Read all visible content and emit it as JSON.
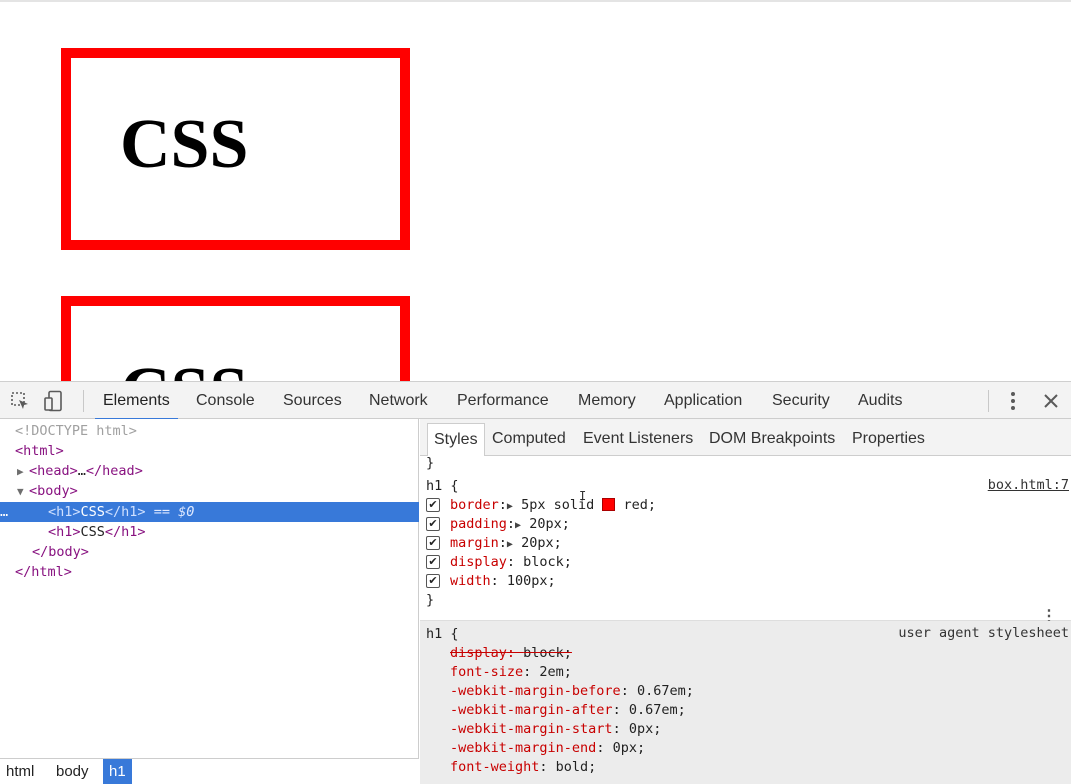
{
  "page": {
    "boxes": [
      {
        "text": "CSS"
      },
      {
        "text": "CSS"
      }
    ]
  },
  "devtools": {
    "toolbar": {
      "tabs": [
        "Elements",
        "Console",
        "Sources",
        "Network",
        "Performance",
        "Memory",
        "Application",
        "Security",
        "Audits"
      ],
      "active_tab": "Elements",
      "icons": [
        "inspect-element-icon",
        "device-toolbar-icon",
        "more-options-icon",
        "close-icon"
      ]
    },
    "elements": {
      "lines": {
        "doctype": "<!DOCTYPE html>",
        "html_open": "<html>",
        "head_open": "<head>",
        "head_ellipsis": "…",
        "head_close": "</head>",
        "body_open": "<body>",
        "h1_open": "<h1>",
        "h1_text": "CSS",
        "h1_close": "</h1>",
        "selected_marker": "== $0",
        "body_close": "</body>",
        "html_close": "</html>"
      },
      "row_ellipsis": "…",
      "breadcrumb": [
        "html",
        "body",
        "h1"
      ]
    },
    "styles": {
      "tabs": [
        "Styles",
        "Computed",
        "Event Listeners",
        "DOM Breakpoints",
        "Properties"
      ],
      "active_tab": "Styles",
      "prev_rule_close": "}",
      "rule1": {
        "selector": "h1 {",
        "source": "box.html:7",
        "close": "}",
        "declarations": [
          {
            "prop": "border",
            "value_pre": "5px solid ",
            "value_post": "red;",
            "swatch": "#ff0000"
          },
          {
            "prop": "padding",
            "value": "20px;"
          },
          {
            "prop": "margin",
            "value": "20px;"
          },
          {
            "prop": "display",
            "value": "block;"
          },
          {
            "prop": "width",
            "value": "100px;"
          }
        ]
      },
      "rule2": {
        "selector": "h1 {",
        "source": "user agent stylesheet",
        "declarations": [
          {
            "prop": "display",
            "value": "block;",
            "overridden": true
          },
          {
            "prop": "font-size",
            "value": "2em;"
          },
          {
            "prop": "-webkit-margin-before",
            "value": "0.67em;"
          },
          {
            "prop": "-webkit-margin-after",
            "value": "0.67em;"
          },
          {
            "prop": "-webkit-margin-start",
            "value": "0px;"
          },
          {
            "prop": "-webkit-margin-end",
            "value": "0px;"
          },
          {
            "prop": "font-weight",
            "value": "bold;"
          }
        ]
      }
    },
    "colors": {
      "accent": "#3879d9",
      "property": "#c80000",
      "tag": "#881280",
      "demo_border": "#ff0000"
    }
  }
}
